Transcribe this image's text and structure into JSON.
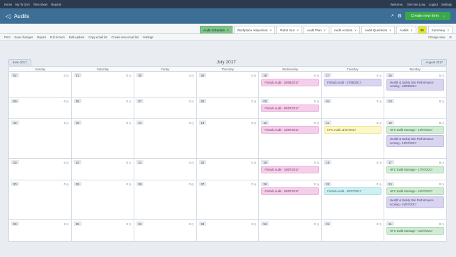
{
  "topbar": {
    "left": [
      "Home",
      "My To Do's",
      "Time sheet",
      "Reports"
    ],
    "right": [
      "Welcome,",
      "Gert Van Looy",
      "Logout",
      "Settings"
    ]
  },
  "header": {
    "title": "Audits",
    "new_item": "Create new item"
  },
  "tabs": [
    {
      "label": "Summary"
    },
    {
      "label": "30",
      "count": true
    },
    {
      "label": "Audits"
    },
    {
      "label": "Audit Questions"
    },
    {
      "label": "Audit Actions"
    },
    {
      "label": "Audit Plan"
    },
    {
      "label": "Patrol tour"
    },
    {
      "label": "Workplace Inspection"
    },
    {
      "label": "Audit Schedule",
      "active": true
    }
  ],
  "toolbar": {
    "left": [
      "Settings",
      "Create new email list",
      "Copy email list",
      "Bulk update",
      "Full Screen",
      "Report",
      "Save changes",
      "Print"
    ],
    "right": "Change view"
  },
  "calendar": {
    "month": "July 2017",
    "prev": "June 2017",
    "next": "August 2017",
    "days": [
      "Monday",
      "Tuesday",
      "Wednesday",
      "Thursday",
      "Friday",
      "Saturday",
      "Sunday"
    ],
    "weeks": [
      [
        {
          "n": "26",
          "c": "0",
          "ev": [
            {
              "t": "Health &amp; Safety Site Performance scoring - 26/06/2017",
              "c": "purple"
            }
          ]
        },
        {
          "n": "27",
          "c": "0",
          "ev": [
            {
              "t": "FinSub Audit - 27/06/2017",
              "c": "purple"
            }
          ]
        },
        {
          "n": "28",
          "c": "0",
          "ev": [
            {
              "t": "FinSub Audit - 28/06/2017",
              "c": "pink"
            }
          ]
        },
        {
          "n": "29",
          "c": "0",
          "ev": []
        },
        {
          "n": "30",
          "c": "0",
          "ev": []
        },
        {
          "n": "01",
          "c": "0",
          "ev": []
        },
        {
          "n": "02",
          "c": "0",
          "ev": []
        }
      ],
      [
        {
          "n": "03",
          "c": "0",
          "ev": []
        },
        {
          "n": "04",
          "c": "0",
          "ev": []
        },
        {
          "n": "05",
          "c": "0",
          "ev": [
            {
              "t": "FinSub Audit - 05/07/2017",
              "c": "pink"
            }
          ]
        },
        {
          "n": "06",
          "c": "0",
          "ev": []
        },
        {
          "n": "07",
          "c": "0",
          "ev": []
        },
        {
          "n": "08",
          "c": "0",
          "ev": []
        },
        {
          "n": "09",
          "c": "0",
          "ev": []
        }
      ],
      [
        {
          "n": "10",
          "c": "0",
          "ev": [
            {
              "t": "HFC Build Montage - 10/07/2017",
              "c": "green"
            },
            {
              "t": "Health &amp; Safety Site Performance scoring - 10/07/2017",
              "c": "purple"
            }
          ]
        },
        {
          "n": "11",
          "c": "0",
          "ev": [
            {
              "t": "HFC Audit 11/07/2017",
              "c": "yellow"
            }
          ]
        },
        {
          "n": "12",
          "c": "0",
          "ev": [
            {
              "t": "FinSub Audit - 12/07/2017",
              "c": "pink"
            }
          ]
        },
        {
          "n": "13",
          "c": "0",
          "ev": []
        },
        {
          "n": "14",
          "c": "0",
          "ev": []
        },
        {
          "n": "15",
          "c": "0",
          "ev": []
        },
        {
          "n": "16",
          "c": "0",
          "ev": []
        }
      ],
      [
        {
          "n": "17",
          "c": "0",
          "ev": [
            {
              "t": "HFC Build Montage - 17/07/2017",
              "c": "green"
            }
          ]
        },
        {
          "n": "18",
          "c": "0",
          "ev": []
        },
        {
          "n": "19",
          "c": "0",
          "ev": [
            {
              "t": "FinSub Audit - 19/07/2017",
              "c": "pink"
            }
          ]
        },
        {
          "n": "20",
          "c": "0",
          "ev": []
        },
        {
          "n": "21",
          "c": "0",
          "ev": []
        },
        {
          "n": "22",
          "c": "0",
          "ev": []
        },
        {
          "n": "23",
          "c": "0",
          "ev": []
        }
      ],
      [
        {
          "n": "24",
          "c": "0",
          "ev": [
            {
              "t": "HFC Build Montage - 24/07/2017",
              "c": "green"
            },
            {
              "t": "Health &amp; Safety Site Performance scoring - 24/07/2017",
              "c": "purple"
            }
          ]
        },
        {
          "n": "25",
          "c": "0",
          "ev": [
            {
              "t": "FinSub Audit - 25/07/2017",
              "c": "cyan"
            }
          ]
        },
        {
          "n": "26",
          "c": "0",
          "ev": [
            {
              "t": "FinSub Audit - 26/07/2017",
              "c": "pink"
            }
          ]
        },
        {
          "n": "27",
          "c": "0",
          "ev": []
        },
        {
          "n": "28",
          "c": "0",
          "ev": []
        },
        {
          "n": "29",
          "c": "0",
          "ev": []
        },
        {
          "n": "30",
          "c": "0",
          "ev": []
        }
      ],
      [
        {
          "n": "31",
          "c": "0",
          "ev": [
            {
              "t": "HFC Build Montage - 31/07/2017",
              "c": "green"
            }
          ]
        },
        {
          "n": "01",
          "c": "0",
          "ev": []
        },
        {
          "n": "02",
          "c": "0",
          "ev": []
        },
        {
          "n": "03",
          "c": "0",
          "ev": []
        },
        {
          "n": "04",
          "c": "0",
          "ev": []
        },
        {
          "n": "05",
          "c": "0",
          "ev": []
        },
        {
          "n": "06",
          "c": "0",
          "ev": []
        }
      ]
    ]
  }
}
